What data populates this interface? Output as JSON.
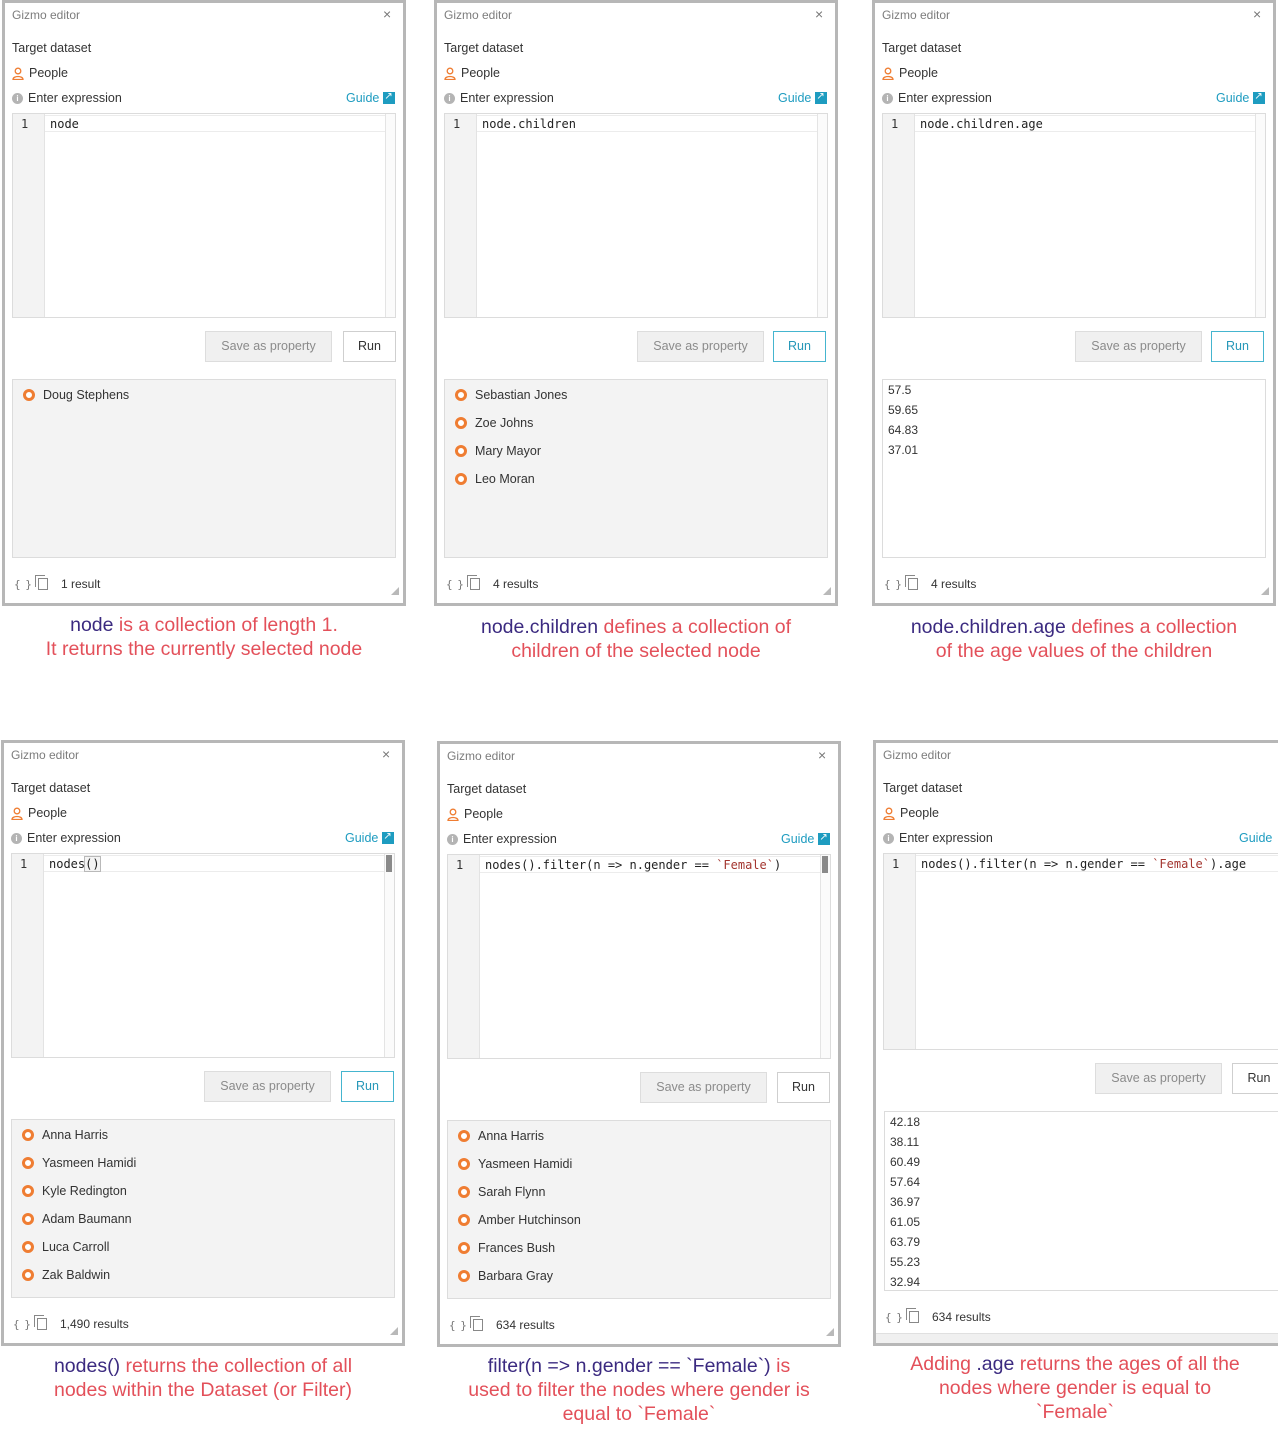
{
  "common": {
    "editor_title": "Gizmo editor",
    "close": "×",
    "target_label": "Target dataset",
    "dataset": "People",
    "expr_label": "Enter expression",
    "guide": "Guide",
    "save_label": "Save as property",
    "run_label": "Run",
    "line_number": "1",
    "colors": {
      "accent": "#1e9cc0",
      "node_ring": "#ef7d32",
      "caption_text": "#e3505a",
      "caption_keyword": "#3b2a80"
    }
  },
  "panels": [
    {
      "code": "node",
      "results": [
        "Doug Stephens"
      ],
      "count": "1 result",
      "caption": {
        "l1k": "node",
        "l1": " is a collection of length 1.",
        "l2": "It returns the currently selected node"
      }
    },
    {
      "code": "node.children",
      "results": [
        "Sebastian Jones",
        "Zoe Johns",
        "Mary Mayor",
        "Leo Moran"
      ],
      "count": "4 results",
      "caption": {
        "l1k": "node.children",
        "l1": " defines a collection of",
        "l2": "children of the selected node"
      }
    },
    {
      "code": "node.children.age",
      "values": [
        "57.5",
        "59.65",
        "64.83",
        "37.01"
      ],
      "count": "4 results",
      "caption": {
        "l1k": "node.children.age",
        "l1": " defines a collection",
        "l2": "of the age values of the children"
      }
    },
    {
      "code_a": "nodes",
      "code_b": "()",
      "results": [
        "Anna Harris",
        "Yasmeen Hamidi",
        "Kyle Redington",
        "Adam Baumann",
        "Luca Carroll",
        "Zak Baldwin"
      ],
      "count": "1,490 results",
      "caption": {
        "l1k": "nodes()",
        "l1": " returns the collection of all",
        "l2": "nodes within the Dataset (or Filter)"
      }
    },
    {
      "code_a": "nodes().filter(n => n.gender == ",
      "code_str": "`Female`",
      "code_b": ")",
      "results": [
        "Anna Harris",
        "Yasmeen Hamidi",
        "Sarah Flynn",
        "Amber Hutchinson",
        "Frances Bush",
        "Barbara Gray"
      ],
      "count": "634 results",
      "caption": {
        "l1k": "filter(n => n.gender == `Female`)",
        "l1": " is",
        "l2": "used to filter the nodes where gender is",
        "l3": "equal to `Female`"
      }
    },
    {
      "code_a": "nodes().filter(n => n.gender == ",
      "code_str": "`Female`",
      "code_b": ").age",
      "values": [
        "42.18",
        "38.11",
        "60.49",
        "57.64",
        "36.97",
        "61.05",
        "63.79",
        "55.23",
        "32.94"
      ],
      "count": "634 results",
      "caption": {
        "l1a": "Adding ",
        "l1k": ".age",
        "l1": " returns the ages of all the",
        "l2": "nodes where gender is equal to",
        "l3": "`Female`"
      }
    }
  ]
}
